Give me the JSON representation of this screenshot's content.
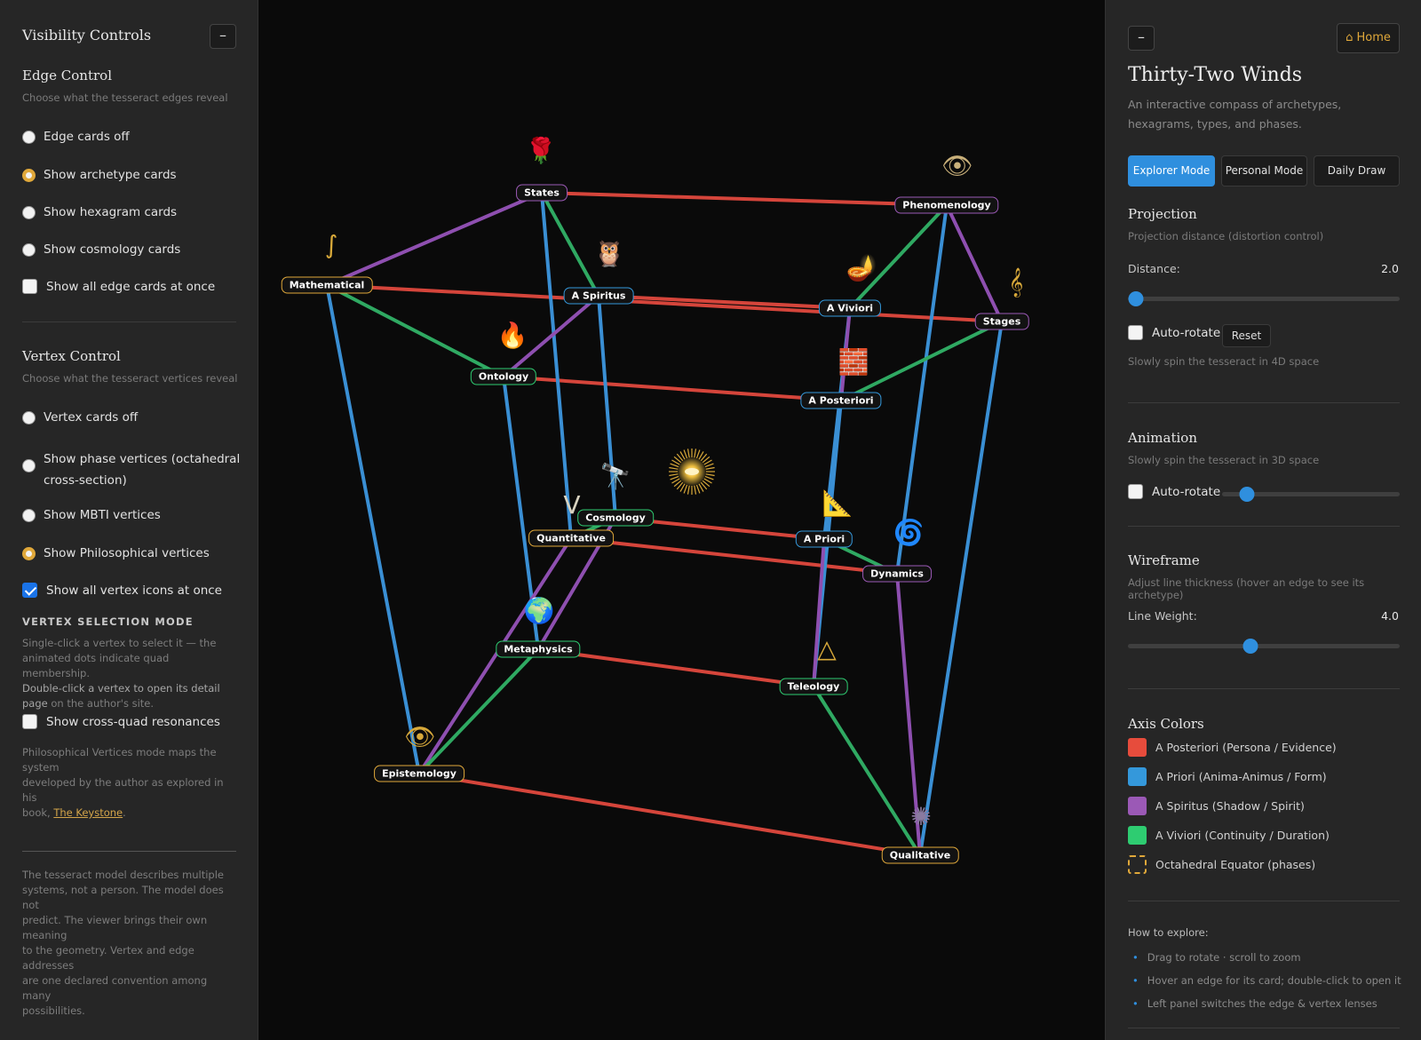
{
  "left": {
    "title": "Visibility Controls",
    "collapse_label": "–",
    "edge_control": {
      "title": "Edge Control",
      "subtitle": "Choose what the tesseract edges reveal",
      "options": [
        {
          "label": "Edge cards off",
          "selected": false
        },
        {
          "label": "Show archetype cards",
          "selected": true
        },
        {
          "label": "Show hexagram cards",
          "selected": false
        },
        {
          "label": "Show cosmology cards",
          "selected": false
        }
      ],
      "all_at_once": {
        "label": "Show all edge cards at once",
        "checked": false
      }
    },
    "vertex_control": {
      "title": "Vertex Control",
      "subtitle": "Choose what the tesseract vertices reveal",
      "options": [
        {
          "label": "Vertex cards off",
          "selected": false
        },
        {
          "label": "Show phase vertices (octahedral",
          "label2": "cross-section)",
          "selected": false
        },
        {
          "label": "Show MBTI vertices",
          "selected": false
        },
        {
          "label": "Show Philosophical vertices",
          "selected": true
        }
      ],
      "all_icons": {
        "label": "Show all vertex icons at once",
        "checked": true
      }
    },
    "selection_mode": {
      "heading": "VERTEX SELECTION MODE",
      "line1": "Single-click a vertex to select it — the",
      "line2": "animated dots indicate quad membership.",
      "line3_bold": "Double-click a vertex to open its detail",
      "line4_bold": "page",
      "line4_rest": " on the author's site."
    },
    "cross_quad": {
      "label": "Show cross-quad resonances",
      "checked": false
    },
    "philosophy_note": {
      "line1": "Philosophical Vertices mode maps the system",
      "line2": "developed by the author as explored in his",
      "line3_prefix": "book, ",
      "link": "The Keystone",
      "line3_suffix": "."
    },
    "disclaimer": [
      "The tesseract model describes multiple",
      "systems, not a person. The model does not",
      "predict. The viewer brings their own meaning",
      "to the geometry. Vertex and edge addresses",
      "are one declared convention among many",
      "possibilities."
    ]
  },
  "right": {
    "collapse_label": "–",
    "home_label": "⌂ Home",
    "title": "Thirty-Two Winds",
    "subtitle": "An interactive compass of archetypes, hexagrams, types, and phases.",
    "modes": [
      {
        "label": "Explorer Mode",
        "active": true
      },
      {
        "label": "Personal Mode",
        "active": false
      },
      {
        "label": "Daily Draw",
        "active": false
      }
    ],
    "projection": {
      "title": "Projection",
      "subtitle": "Projection distance (distortion control)",
      "distance_label": "Distance:",
      "distance_value": "2.0",
      "distance_fraction": 0.03,
      "auto_rotate_label": "Auto-rotate",
      "auto_rotate_checked": false,
      "reset_label": "Reset",
      "note": "Slowly spin the tesseract in 4D space"
    },
    "animation": {
      "title": "Animation",
      "subtitle": "Slowly spin the tesseract in 3D space",
      "auto_rotate_label": "Auto-rotate",
      "auto_rotate_checked": false,
      "speed_fraction": 0.14
    },
    "wireframe": {
      "title": "Wireframe",
      "subtitle": "Adjust line thickness (hover an edge to see its archetype)",
      "weight_label": "Line Weight:",
      "weight_value": "4.0",
      "weight_fraction": 0.45
    },
    "axis_colors": {
      "title": "Axis Colors",
      "items": [
        {
          "label": "A Posteriori (Persona / Evidence)",
          "color": "#e74c3c"
        },
        {
          "label": "A Priori (Anima-Animus / Form)",
          "color": "#3498db"
        },
        {
          "label": "A Spiritus (Shadow / Spirit)",
          "color": "#9b59b6"
        },
        {
          "label": "A Viviori (Continuity / Duration)",
          "color": "#2ecc71"
        },
        {
          "label": "Octahedral Equator (phases)",
          "color": "#e0a83a",
          "dashed": true
        }
      ]
    },
    "how_to": {
      "title": "How to explore:",
      "items": [
        "Drag to rotate · scroll to zoom",
        "Hover an edge for its card; double-click to open it",
        "Left panel switches the edge & vertex lenses"
      ]
    }
  },
  "tesseract": {
    "axis_colors": {
      "posteriori": "#d5453b",
      "priori": "#3a8fd4",
      "spiritus": "#8e4fb0",
      "viviori": "#2fa962"
    },
    "vertices": [
      {
        "id": "states",
        "label": "States",
        "border": "#9b59b6",
        "icon": "🌹"
      },
      {
        "id": "phenomenology",
        "label": "Phenomenology",
        "border": "#9b59b6",
        "icon": "👁"
      },
      {
        "id": "mathematical",
        "label": "Mathematical",
        "border": "#e0a83a",
        "icon": "∫"
      },
      {
        "id": "aspiritus",
        "label": "A Spiritus",
        "border": "#3498db",
        "icon": "🦉"
      },
      {
        "id": "aviviori",
        "label": "A Viviori",
        "border": "#3498db",
        "icon": "🪔"
      },
      {
        "id": "stages",
        "label": "Stages",
        "border": "#9b59b6",
        "icon": "𝄞"
      },
      {
        "id": "ontology",
        "label": "Ontology",
        "border": "#2ecc71",
        "icon": "🔥"
      },
      {
        "id": "aposteriori",
        "label": "A Posteriori",
        "border": "#3498db",
        "icon": "🧱"
      },
      {
        "id": "cosmology",
        "label": "Cosmology",
        "border": "#2ecc71",
        "icon": "🔭"
      },
      {
        "id": "quantitative",
        "label": "Quantitative",
        "border": "#e0a83a",
        "icon": "V"
      },
      {
        "id": "apriori",
        "label": "A Priori",
        "border": "#3498db",
        "icon": "📐"
      },
      {
        "id": "dynamics",
        "label": "Dynamics",
        "border": "#9b59b6",
        "icon": "🌀"
      },
      {
        "id": "metaphysics",
        "label": "Metaphysics",
        "border": "#2ecc71",
        "icon": "🌍"
      },
      {
        "id": "teleology",
        "label": "Teleology",
        "border": "#2ecc71",
        "icon": "△"
      },
      {
        "id": "epistemology",
        "label": "Epistemology",
        "border": "#e0a83a",
        "icon": "👁"
      },
      {
        "id": "qualitative",
        "label": "Qualitative",
        "border": "#e0a83a",
        "icon": "✺"
      }
    ],
    "center_icon": "☀"
  }
}
